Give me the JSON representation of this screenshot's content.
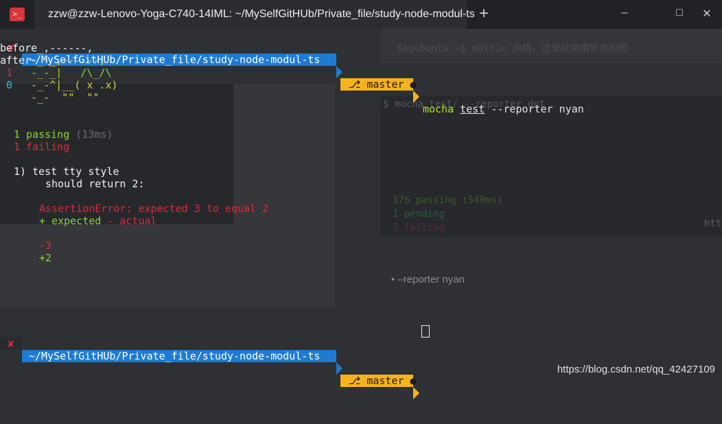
{
  "titlebar": {
    "app_icon": ">_",
    "tab_title": "zzw@zzw-Lenovo-Yoga-C740-14IML: ~/MySelfGitHUb/Private_file/study-node-modul-ts",
    "new_tab": "+",
    "minimize": "–",
    "maximize": "□",
    "close": "✕"
  },
  "prompt": {
    "status": "✘",
    "path": "~/MySelfGitHUb/Private_file/study-node-modul-ts",
    "branch_icon": "⎇",
    "branch": "master",
    "dirty": "●",
    "command_mocha": "mocha",
    "command_test": "test",
    "command_rest": "--reporter nyan"
  },
  "nyan": {
    "line1": "before_,------,",
    "line2_a": "after",
    "line2_b": "-_-_,------,",
    "line3_num": " 1",
    "line3_art": "   -_-_|   /\\_/\\",
    "line4_num": " 0",
    "line4_art": "   -_-^|__( x .x)",
    "line5": "     -_-  \"\"  \"\""
  },
  "results": {
    "passing_count": "1 passing",
    "passing_time": "(13ms)",
    "failing": "1 failing",
    "test_title": "1) test tty style",
    "test_case": "should return 2:",
    "error": "AssertionError: expected 3 to equal 2",
    "legend_expected": "+ expected",
    "legend_actual": "- actual",
    "actual_value": "-3",
    "expected_value": "+2"
  },
  "background": {
    "ghost_cmd": "$ mocha test/ --reporter dot",
    "ghost_line1": "176 passing (549ms)",
    "ghost_line2": "1 pending",
    "ghost_line3": "1 failing",
    "ghost_bullet": "–reporter nyan",
    "ghost_note": "$agubuntu:~$ matrix 风格，这里就使用官方的图",
    "ghost_http": "http"
  },
  "watermark": "https://blog.csdn.net/qq_42427109"
}
